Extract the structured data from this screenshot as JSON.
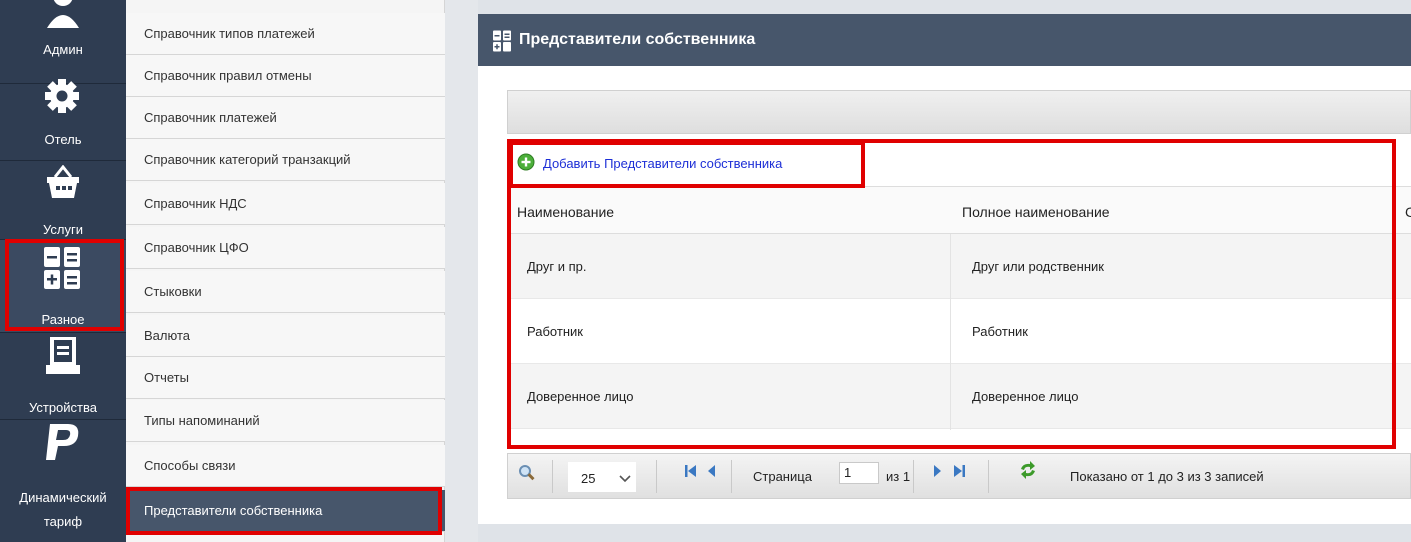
{
  "rail": {
    "items": [
      {
        "label": "Админ",
        "icon": "user-icon"
      },
      {
        "label": "Отель",
        "icon": "gear-icon"
      },
      {
        "label": "Услуги",
        "icon": "basket-icon"
      },
      {
        "label": "Разное",
        "icon": "calculator-icon"
      },
      {
        "label": "Устройства",
        "icon": "printer-icon"
      },
      {
        "label_line1": "Динамический",
        "label_line2": "тариф",
        "icon": "paypal-icon"
      }
    ]
  },
  "submenu": {
    "items": [
      "Справочник типов платежей",
      "Справочник правил отмены",
      "Справочник платежей",
      "Справочник категорий транзакций",
      "Справочник НДС",
      "Справочник ЦФО",
      "Стыковки",
      "Валюта",
      "Отчеты",
      "Типы напоминаний",
      "Способы связи",
      "Представители собственника"
    ]
  },
  "panel": {
    "title": "Представители собственника",
    "add_label": "Добавить Представители собственника",
    "columns": [
      "Наименование",
      "Полное наименование",
      "С"
    ],
    "rows": [
      [
        "Друг и пр.",
        "Друг или родственник"
      ],
      [
        "Работник",
        "Работник"
      ],
      [
        "Доверенное лицо",
        "Доверенное лицо"
      ]
    ]
  },
  "pager": {
    "page_size": "25",
    "page_label": "Страница",
    "page_value": "1",
    "of_label": "из 1",
    "summary": "Показано от 1 до 3 из 3 записей"
  },
  "colors": {
    "rail_bg": "#2f3d52",
    "header_bg": "#47566b",
    "highlight": "#e00000",
    "link": "#1d2fd6"
  }
}
